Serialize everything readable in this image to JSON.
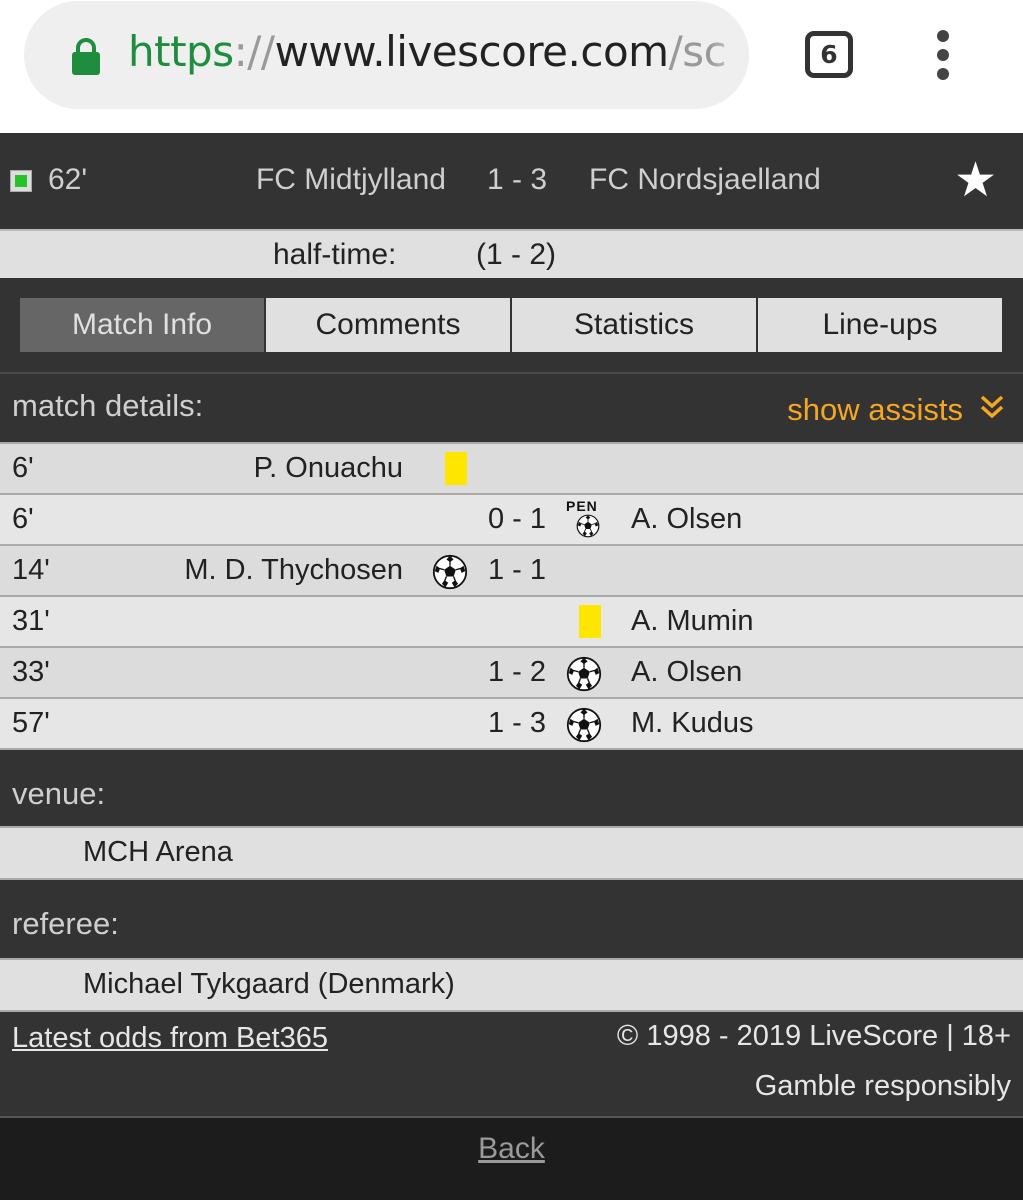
{
  "browser": {
    "url_scheme": "https",
    "url_sep": "://",
    "url_host": "www.livescore.com",
    "url_path": "/sc",
    "tab_count": "6"
  },
  "match": {
    "minute": "62'",
    "home_team": "FC Midtjylland",
    "score": "1 - 3",
    "away_team": "FC Nordsjaelland",
    "halftime_label": "half-time:",
    "halftime_score": "(1 - 2)"
  },
  "tabs": {
    "match_info": "Match Info",
    "comments": "Comments",
    "statistics": "Statistics",
    "lineups": "Line-ups"
  },
  "details": {
    "title": "match details:",
    "show_assists": "show assists"
  },
  "events": [
    {
      "minute": "6'",
      "home_player": "P. Onuachu",
      "score": "",
      "away_player": ""
    },
    {
      "minute": "6'",
      "home_player": "",
      "score": "0 - 1",
      "away_player": "A. Olsen",
      "pen_label": "PEN"
    },
    {
      "minute": "14'",
      "home_player": "M. D. Thychosen",
      "score": "1 - 1",
      "away_player": ""
    },
    {
      "minute": "31'",
      "home_player": "",
      "score": "",
      "away_player": "A. Mumin"
    },
    {
      "minute": "33'",
      "home_player": "",
      "score": "1 - 2",
      "away_player": "A. Olsen"
    },
    {
      "minute": "57'",
      "home_player": "",
      "score": "1 - 3",
      "away_player": "M. Kudus"
    }
  ],
  "venue": {
    "label": "venue:",
    "value": "MCH Arena"
  },
  "referee": {
    "label": "referee:",
    "value": "Michael Tykgaard (Denmark)"
  },
  "footer": {
    "odds_link": "Latest odds from Bet365",
    "copyright": "© 1998 - 2019 LiveScore | 18+",
    "gamble": "Gamble responsibly",
    "back": "Back"
  },
  "colors": {
    "accent": "#f5a623",
    "yellow_card": "#ffe600",
    "live_green": "#27c227",
    "secure_green": "#1e8e3e"
  },
  "icons": {
    "lock": "lock-icon",
    "star": "star-icon",
    "ball": "football-icon",
    "yellow_card": "yellow-card-icon",
    "chevron": "double-chevron-down-icon"
  }
}
